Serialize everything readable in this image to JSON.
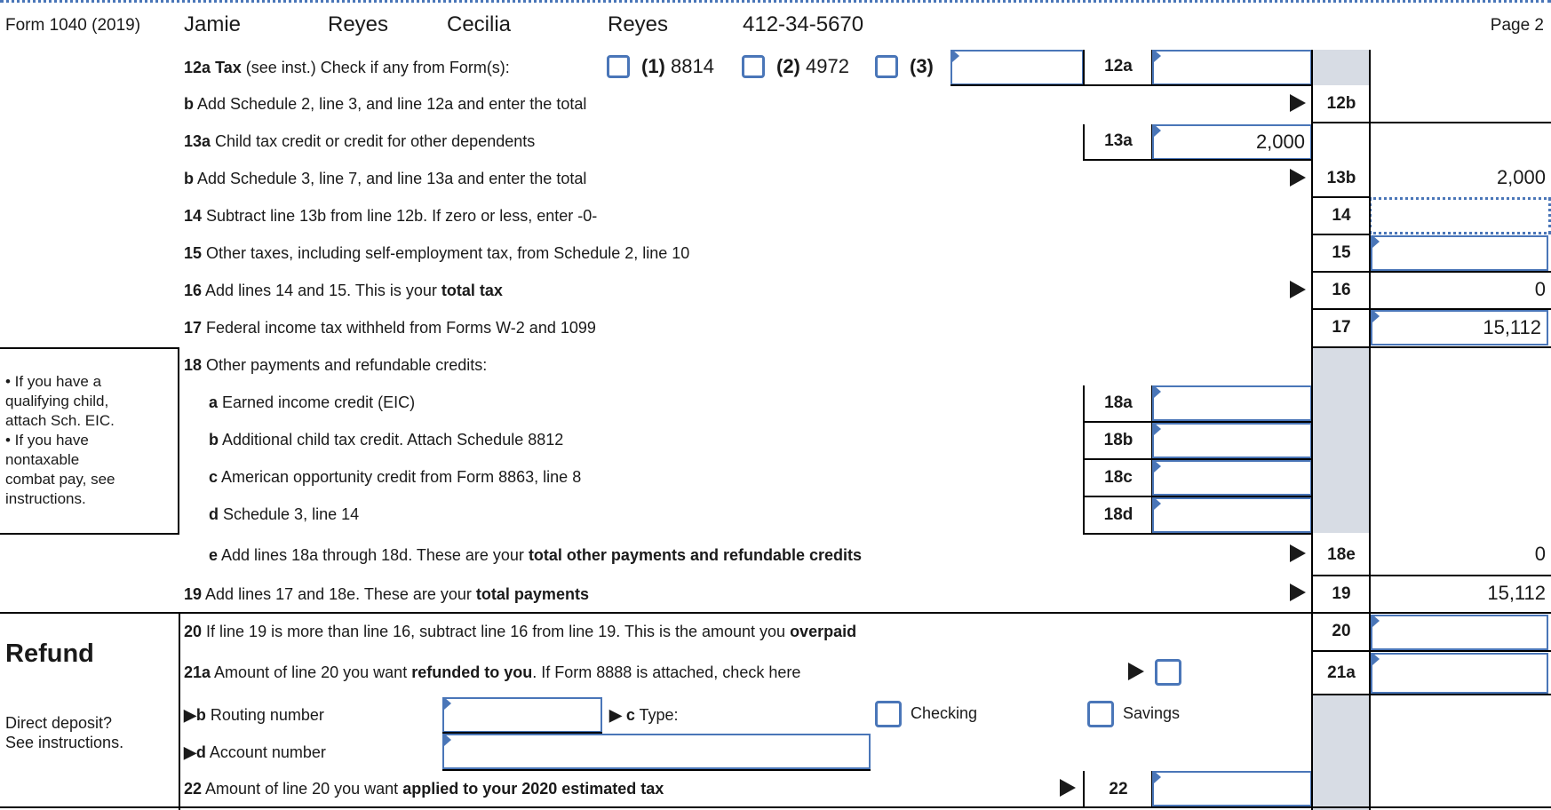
{
  "header": {
    "form_label": "Form 1040 (2019)",
    "first_name": "Jamie",
    "last_name": "Reyes",
    "spouse_first_name": "Cecilia",
    "spouse_last_name": "Reyes",
    "ssn": "412-34-5670",
    "page": "Page 2"
  },
  "lines": {
    "l12a": {
      "num": "12a",
      "title": "Tax",
      "desc": " (see inst.) Check if any from Form(s):",
      "opt1_num": "(1)",
      "opt1_form": " 8814",
      "opt2_num": "(2)",
      "opt2_form": " 4972",
      "opt3_num": "(3)",
      "label": "12a",
      "value": "",
      "other_form_value": ""
    },
    "l12b": {
      "num": "b",
      "desc": " Add Schedule 2, line 3, and line 12a and enter the total",
      "label": "12b",
      "value": ""
    },
    "l13a": {
      "num": "13a",
      "desc": " Child tax credit or credit for other dependents",
      "label": "13a",
      "value": "2,000"
    },
    "l13b": {
      "num": "b",
      "desc": " Add Schedule 3, line 7, and line 13a and enter the total",
      "label": "13b",
      "value": "2,000"
    },
    "l14": {
      "num": "14",
      "desc": " Subtract line 13b from line 12b. If zero or less, enter -0-",
      "label": "14",
      "value": ""
    },
    "l15": {
      "num": "15",
      "desc": " Other taxes, including self-employment tax, from Schedule 2, line 10",
      "label": "15",
      "value": ""
    },
    "l16": {
      "num": "16",
      "desc": " Add lines 14 and 15. This is your ",
      "bold": "total tax",
      "label": "16",
      "value": "0"
    },
    "l17": {
      "num": "17",
      "desc": " Federal income tax withheld from Forms W-2 and 1099",
      "label": "17",
      "value": "15,112"
    },
    "l18": {
      "num": "18",
      "desc": " Other payments and refundable credits:"
    },
    "l18a": {
      "num": "a",
      "desc": " Earned income credit (EIC)",
      "label": "18a",
      "value": ""
    },
    "l18b": {
      "num": "b",
      "desc": " Additional child tax credit. Attach Schedule 8812",
      "label": "18b",
      "value": ""
    },
    "l18c": {
      "num": "c",
      "desc": " American opportunity credit from Form 8863, line 8",
      "label": "18c",
      "value": ""
    },
    "l18d": {
      "num": "d",
      "desc": " Schedule 3, line 14",
      "label": "18d",
      "value": ""
    },
    "l18e": {
      "num": "e",
      "desc": " Add lines 18a through 18d. These are your ",
      "bold": "total other payments and refundable credits",
      "label": "18e",
      "value": "0"
    },
    "l19": {
      "num": "19",
      "desc": " Add lines 17 and 18e. These are your ",
      "bold": "total payments",
      "label": "19",
      "value": "15,112"
    },
    "l20": {
      "num": "20",
      "desc": " If line 19 is more than line 16, subtract line 16 from line 19. This is the amount you ",
      "bold": "overpaid",
      "label": "20",
      "value": ""
    },
    "l21a": {
      "num": "21a",
      "desc1": " Amount of line 20 you want ",
      "bold": "refunded to you",
      "desc2": ". If Form 8888 is attached, check here",
      "label": "21a",
      "value": ""
    },
    "l21b": {
      "num": "▶b",
      "desc": " Routing number",
      "value": ""
    },
    "l21c": {
      "num": "▶ c",
      "desc": " Type:",
      "checking": "Checking",
      "savings": "Savings"
    },
    "l21d": {
      "num": "▶d",
      "desc": " Account number",
      "value": ""
    },
    "l22": {
      "num": "22",
      "desc": " Amount of line 20 you want ",
      "bold": "applied to your 2020 estimated tax",
      "label": "22",
      "value": ""
    }
  },
  "sidebar": {
    "eic_note": "• If you have a\nqualifying child,\nattach Sch. EIC.\n• If you have\nnontaxable\ncombat pay, see\ninstructions.",
    "refund_heading": "Refund",
    "direct_deposit_note": "Direct deposit?\nSee instructions."
  },
  "colors": {
    "field_border": "#4a76b8",
    "shaded_column": "#d7dce4"
  }
}
